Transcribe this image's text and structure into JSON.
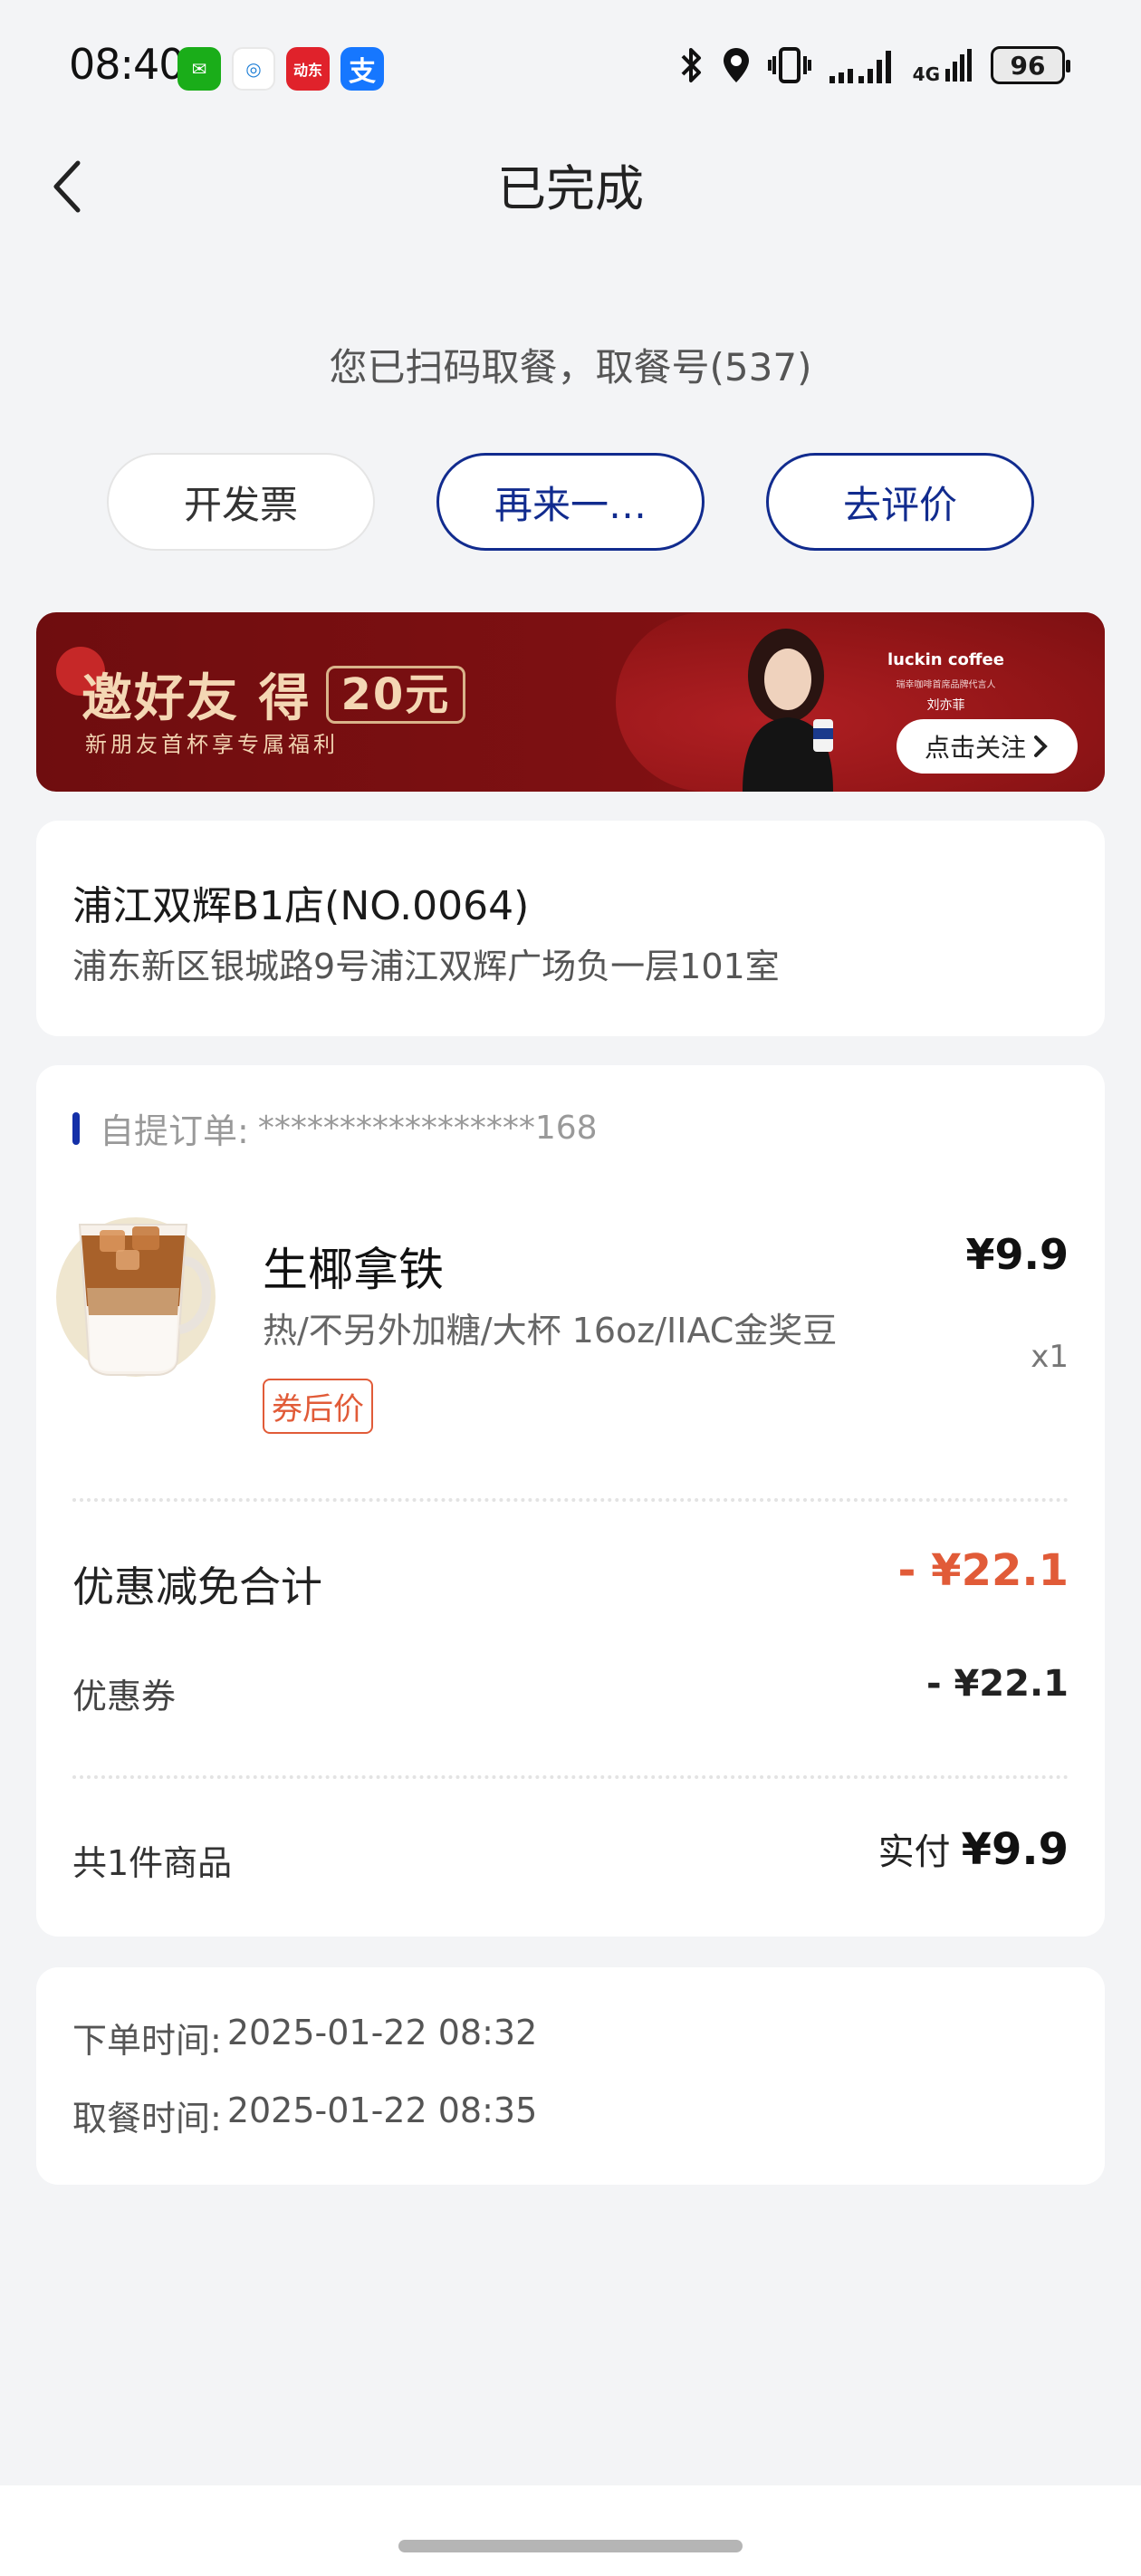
{
  "status_bar": {
    "time": "08:40",
    "apps": [
      {
        "name": "wechat-icon",
        "glyph": "✉"
      },
      {
        "name": "china-mobile-icon",
        "glyph": "◎"
      },
      {
        "name": "dongfang-icon",
        "glyph": "动东"
      },
      {
        "name": "alipay-icon",
        "glyph": "支"
      }
    ],
    "network": "4G",
    "battery": "96"
  },
  "nav": {
    "title": "已完成"
  },
  "pickup_message": "您已扫码取餐，取餐号(537)",
  "actions": {
    "invoice": "开发票",
    "reorder": "再来一…",
    "review": "去评价"
  },
  "banner": {
    "title": "邀好友 得",
    "amount": "20元",
    "subtitle": "新朋友首杯享专属福利",
    "brand": "luckin coffee",
    "brand_line": "瑞幸咖啡首席品牌代言人",
    "person": "刘亦菲",
    "follow": "点击关注"
  },
  "store": {
    "name": "浦江双辉B1店(NO.0064)",
    "address": "浦东新区银城路9号浦江双辉广场负一层101室"
  },
  "order": {
    "label": "自提订单:",
    "number": "*****************168",
    "product": {
      "name": "生椰拿铁",
      "spec": "热/不另外加糖/大杯 16oz/IIAC金奖豆",
      "tag": "券后价",
      "price": "¥9.9",
      "qty": "x1"
    },
    "discount_total_label": "优惠减免合计",
    "discount_total_value": "- ¥22.1",
    "coupon_label": "优惠券",
    "coupon_value": "- ¥22.1",
    "count_label": "共1件商品",
    "paid_label": "实付",
    "paid_value": "¥9.9"
  },
  "times": {
    "order_label": "下单时间:",
    "order_value": "2025-01-22 08:32",
    "pickup_label": "取餐时间:",
    "pickup_value": "2025-01-22 08:35"
  },
  "colors": {
    "accent_blue": "#112b8e",
    "discount_red": "#e15b38",
    "banner_red": "#7e1012"
  }
}
